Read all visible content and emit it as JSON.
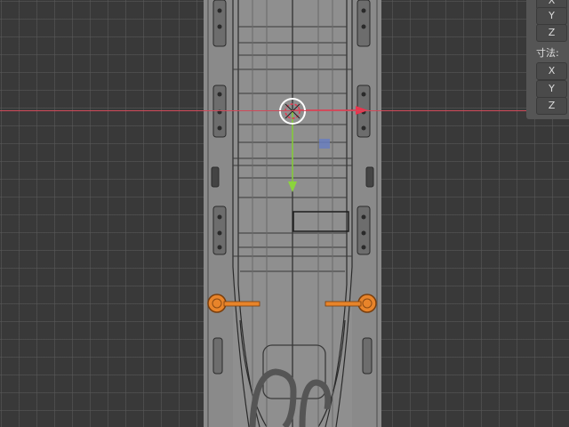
{
  "viewport": {
    "grid_color": "#5a5a5a",
    "background": "#393939"
  },
  "n_panel": {
    "location_axes": [
      "X",
      "Y",
      "Z"
    ],
    "dimensions_label": "寸法:",
    "dimensions_axes": [
      "X",
      "Y",
      "Z"
    ]
  },
  "colors": {
    "x_axis": "#e8364f",
    "y_axis": "#8bd43c",
    "selection": "#e8842a",
    "gizmo_white": "#ffffff"
  }
}
